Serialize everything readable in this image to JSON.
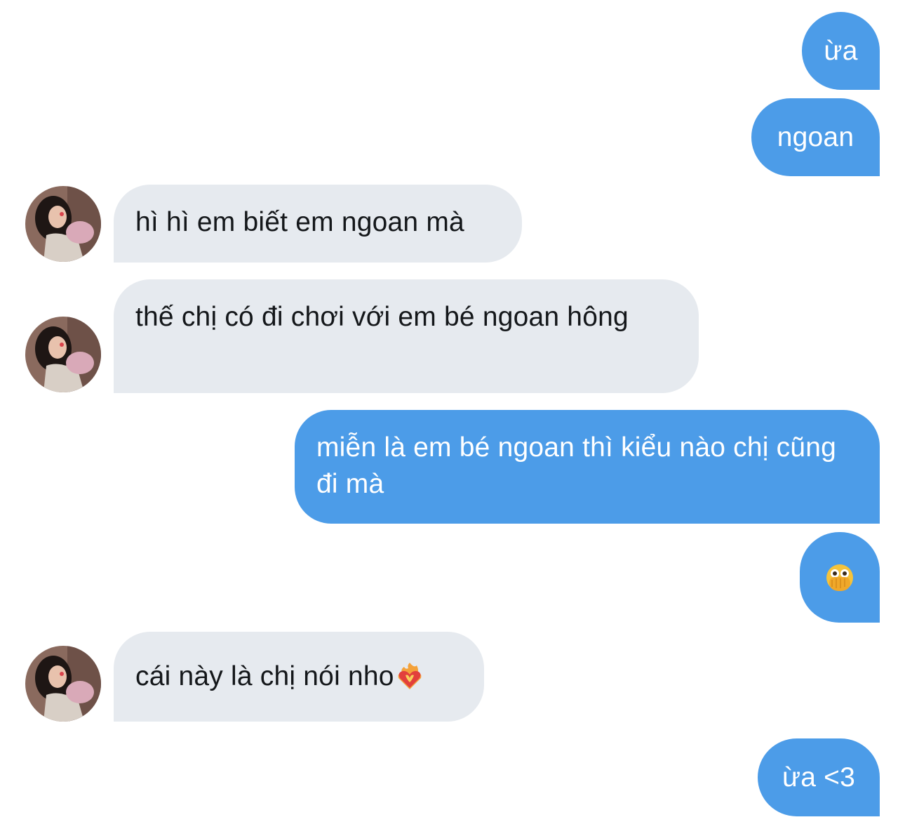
{
  "conversation": {
    "messages": [
      {
        "from": "me",
        "text": "ừa"
      },
      {
        "from": "me",
        "text": "ngoan"
      },
      {
        "from": "them",
        "text": "hì hì em biết em ngoan mà"
      },
      {
        "from": "them",
        "text": "thế chị có đi chơi với em bé ngoan hông"
      },
      {
        "from": "me",
        "text": "miễn là em bé ngoan thì kiểu nào chị cũng đi mà"
      },
      {
        "from": "me",
        "text": "",
        "icon": "face-with-open-eyes-and-hand-over-mouth-emoji"
      },
      {
        "from": "them",
        "text": "cái này là chị nói nho",
        "trailing_icon": "heart-on-fire-emoji"
      },
      {
        "from": "me",
        "text": "ừa <3"
      }
    ]
  },
  "colors": {
    "outgoing_bubble": "#4c9ce8",
    "incoming_bubble": "#e6eaef",
    "outgoing_text": "#ffffff",
    "incoming_text": "#14171a"
  }
}
